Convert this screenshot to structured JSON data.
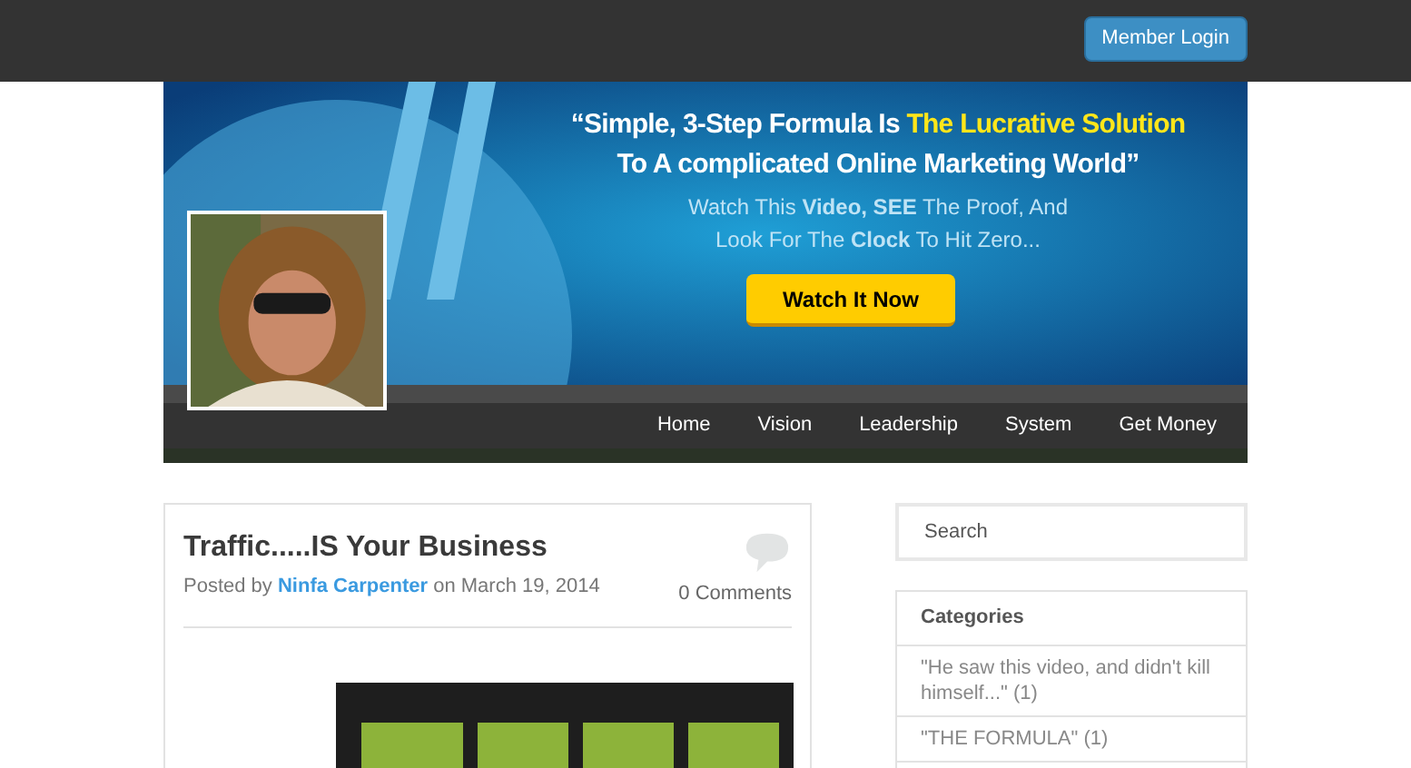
{
  "topbar": {
    "login_button": "Member Login"
  },
  "banner": {
    "headline_lines": [
      [
        {
          "text": "“Simple, 3-Step Formula Is ",
          "highlight": false
        },
        {
          "text": "The Lucrative Solution",
          "highlight": true
        }
      ],
      [
        {
          "text": "To A complicated Online Marketing World”",
          "highlight": false
        }
      ]
    ],
    "subtext_lines": [
      "Watch This **Video, SEE** The Proof, And",
      "Look For The **Clock** To Hit Zero..."
    ],
    "cta": "Watch It Now"
  },
  "nav": {
    "items": [
      {
        "label": "Home"
      },
      {
        "label": "Vision"
      },
      {
        "label": "Leadership"
      },
      {
        "label": "System"
      },
      {
        "label": "Get Money"
      }
    ]
  },
  "post": {
    "title": "Traffic.....IS Your Business",
    "posted_by": "Posted by",
    "author": "Ninfa Carpenter",
    "date": "on March 19, 2014",
    "comments": "0 Comments"
  },
  "sidebar": {
    "search": {
      "placeholder": "Search"
    },
    "categories": {
      "title": "Categories",
      "items": [
        {
          "label": "\"He saw this video, and didn't kill himself...\" (1)"
        },
        {
          "label": "\"THE FORMULA\" (1)"
        }
      ]
    }
  }
}
